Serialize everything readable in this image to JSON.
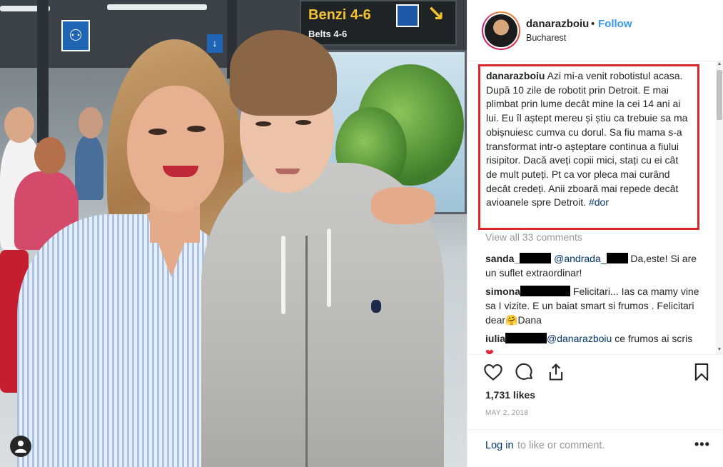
{
  "photo": {
    "signs": {
      "benzi": "Benzi 4-6",
      "belts": "Belts 4-6"
    }
  },
  "post": {
    "username": "danarazboiu",
    "follow_label": "Follow",
    "separator": "•",
    "location": "Bucharest",
    "caption": {
      "username": "danarazboiu",
      "text": "Azi mi-a venit robotistul acasa. După 10 zile de robotit prin Detroit. E mai plimbat prin lume decât mine la cei 14 ani ai lui. Eu îl aștept mereu și știu ca trebuie sa ma obișnuiesc cumva cu dorul. Sa fiu mama s-a transformat intr-o așteptare continua a fiului risipitor. Dacă aveți copii mici, stați cu ei cât de mult puteți. Pt ca vor pleca mai curând decât credeți. Anii zboară mai repede decât avioanele spre Detroit.",
      "hashtag": "#dor"
    },
    "view_all_comments": "View all 33 comments",
    "comments": [
      {
        "user": "sanda_",
        "mention": "@andrada_",
        "text": "Da,este! Si are un suflet extraordinar!"
      },
      {
        "user": "simona",
        "text": "Felicitari... Ias ca mamy vine sa I vizite. E un baiat smart si frumos . Felicitari dear",
        "emoji": "🤗",
        "after": "Dana"
      },
      {
        "user": "iulia",
        "mention": "@danarazboiu",
        "text": "ce frumos ai scris",
        "emoji": "❤"
      }
    ],
    "likes": "1,731 likes",
    "date": "MAY 2, 2018",
    "login_link": "Log in",
    "login_rest": "to like or comment.",
    "more": "•••"
  },
  "icons": {
    "like": "heart-icon",
    "comment": "comment-icon",
    "share": "share-icon",
    "save": "bookmark-icon",
    "user_tag": "user-icon"
  },
  "colors": {
    "link_blue": "#3897f0",
    "mention_navy": "#003569",
    "highlight_red": "#d8262c",
    "muted_gray": "#999999"
  }
}
